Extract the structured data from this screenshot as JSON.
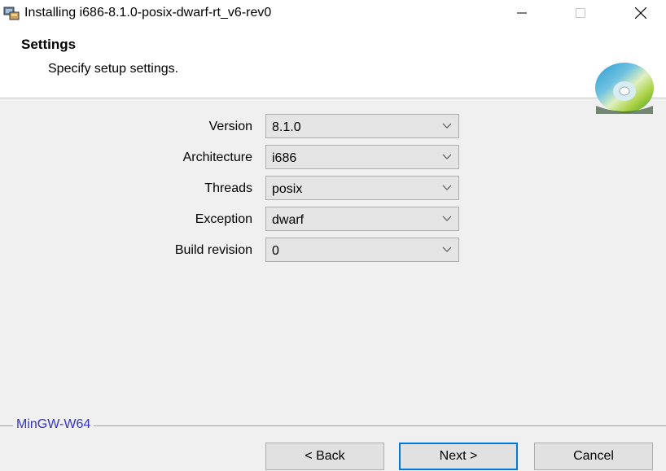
{
  "window": {
    "title": "Installing i686-8.1.0-posix-dwarf-rt_v6-rev0"
  },
  "header": {
    "title": "Settings",
    "subtitle": "Specify setup settings."
  },
  "settings": [
    {
      "label": "Version",
      "value": "8.1.0"
    },
    {
      "label": "Architecture",
      "value": "i686"
    },
    {
      "label": "Threads",
      "value": "posix"
    },
    {
      "label": "Exception",
      "value": "dwarf"
    },
    {
      "label": "Build revision",
      "value": "0"
    }
  ],
  "group": {
    "label": "MinGW-W64"
  },
  "buttons": {
    "back": "< Back",
    "next": "Next >",
    "cancel": "Cancel"
  },
  "colors": {
    "accent": "#0078d7",
    "group_label": "#3333cc"
  }
}
